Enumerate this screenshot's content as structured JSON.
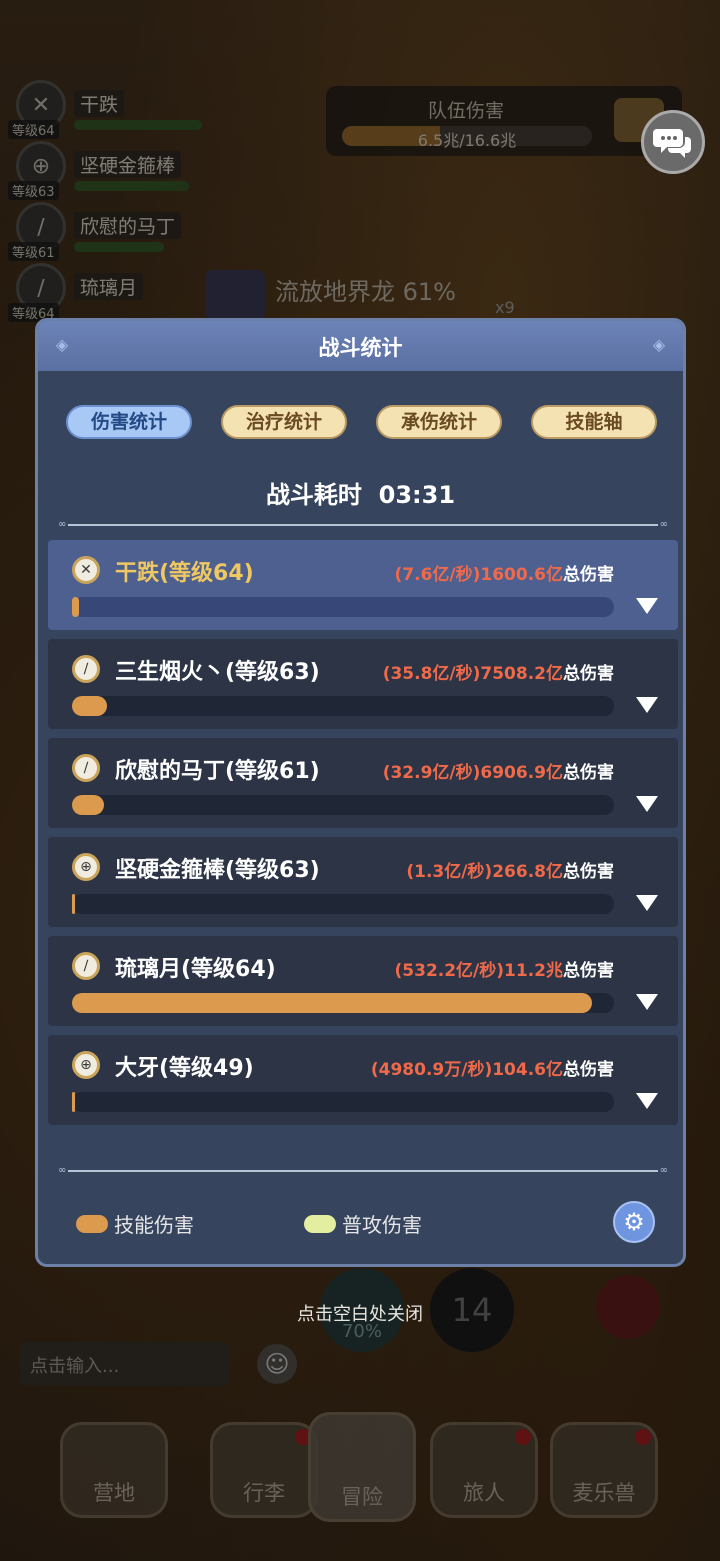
{
  "background": {
    "party": [
      {
        "name": "干跌",
        "level": "等级64",
        "icon": "sword-icon",
        "hp": 1.0
      },
      {
        "name": "坚硬金箍棒",
        "level": "等级63",
        "icon": "shield-icon",
        "hp": 0.9
      },
      {
        "name": "欣慰的马丁",
        "level": "等级61",
        "icon": "staff-icon",
        "hp": 0.7
      },
      {
        "name": "琉璃月",
        "level": "等级64",
        "icon": "staff-icon",
        "hp": 0.0
      }
    ],
    "team_damage": {
      "title": "队伍伤害",
      "value": "6.5兆/16.6兆",
      "progress": 0.39
    },
    "boss": {
      "name": "流放地界龙 61%",
      "count": "x9"
    },
    "cooldown": "14",
    "pet_percent": "70%",
    "chat_input_placeholder": "点击输入...",
    "close_hint": "点击空白处关闭",
    "nav": [
      {
        "label": "营地",
        "active": false,
        "dot": false
      },
      {
        "label": "行李",
        "active": false,
        "dot": true
      },
      {
        "label": "冒险",
        "active": true,
        "dot": false
      },
      {
        "label": "旅人",
        "active": false,
        "dot": true
      },
      {
        "label": "麦乐兽",
        "active": false,
        "dot": true
      }
    ]
  },
  "modal": {
    "title": "战斗统计",
    "tabs": [
      {
        "label": "伤害统计",
        "active": true
      },
      {
        "label": "治疗统计",
        "active": false
      },
      {
        "label": "承伤统计",
        "active": false
      },
      {
        "label": "技能轴",
        "active": false
      }
    ],
    "duration_label": "战斗耗时",
    "duration_value": "03:31",
    "rows": [
      {
        "name": "干跌(等级64)",
        "dps": "(7.6亿/秒)",
        "total": "1600.6亿",
        "total_suffix": "总伤害",
        "icon": "sword-icon",
        "fill": 0.012,
        "selected": true
      },
      {
        "name": "三生烟火丶(等级63)",
        "dps": "(35.8亿/秒)",
        "total": "7508.2亿",
        "total_suffix": "总伤害",
        "icon": "staff-icon",
        "fill": 0.065,
        "selected": false
      },
      {
        "name": "欣慰的马丁(等级61)",
        "dps": "(32.9亿/秒)",
        "total": "6906.9亿",
        "total_suffix": "总伤害",
        "icon": "staff-icon",
        "fill": 0.059,
        "selected": false
      },
      {
        "name": "坚硬金箍棒(等级63)",
        "dps": "(1.3亿/秒)",
        "total": "266.8亿",
        "total_suffix": "总伤害",
        "icon": "shield-icon",
        "fill": 0.003,
        "selected": false
      },
      {
        "name": "琉璃月(等级64)",
        "dps": "(532.2亿/秒)",
        "total": "11.2兆",
        "total_suffix": "总伤害",
        "icon": "staff-icon",
        "fill": 0.96,
        "selected": false
      },
      {
        "name": "大牙(等级49)",
        "dps": "(4980.9万/秒)",
        "total": "104.6亿",
        "total_suffix": "总伤害",
        "icon": "shield-icon",
        "fill": 0.002,
        "selected": false
      }
    ],
    "legend": [
      {
        "label": "技能伤害",
        "color": "#dc9a4e"
      },
      {
        "label": "普攻伤害",
        "color": "#e4eea0"
      }
    ]
  }
}
